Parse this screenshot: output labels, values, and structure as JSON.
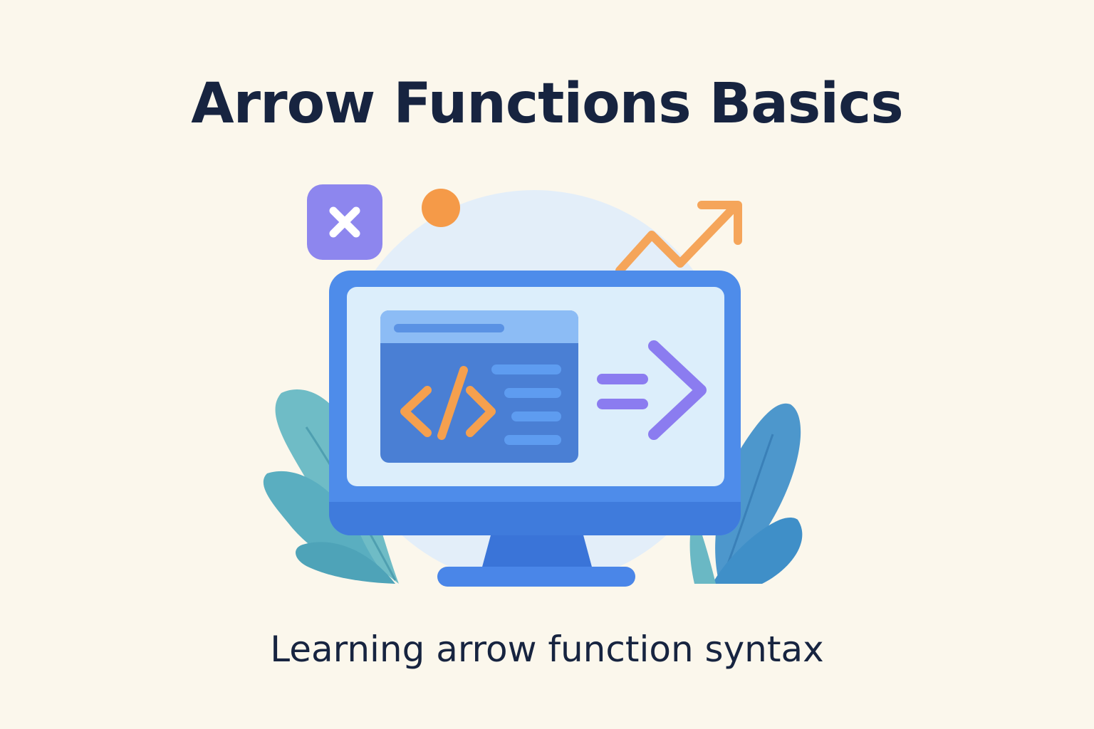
{
  "title": "Arrow Functions Basics",
  "subtitle": "Learning arrow function syntax",
  "illustration": {
    "subject": "computer-monitor",
    "icons": [
      "close-icon",
      "dot-icon",
      "trend-arrow-icon",
      "code-tag-icon",
      "arrow-function-icon",
      "leaf-icon"
    ]
  },
  "colors": {
    "background": "#fbf7ec",
    "text": "#172440",
    "monitor_blue": "#4a86e8",
    "screen": "#dceefb",
    "purple": "#8b7cf0",
    "orange": "#f5a04e",
    "teal": "#5bb3c0"
  }
}
